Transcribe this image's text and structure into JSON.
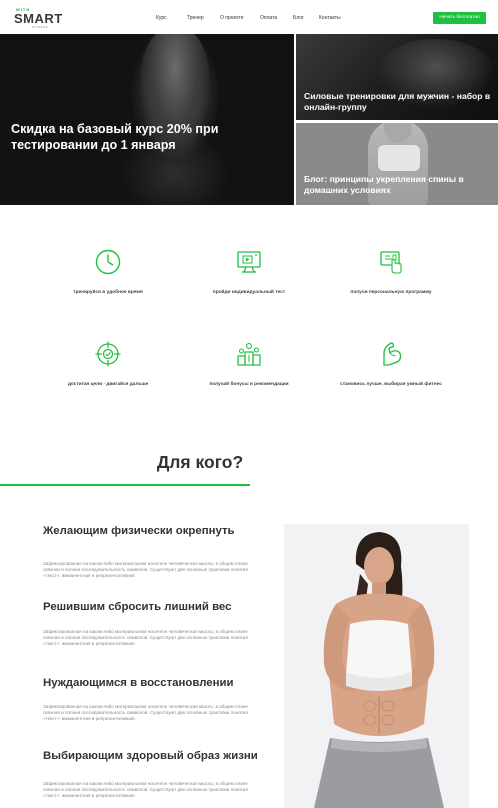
{
  "header": {
    "logo_small": "WITH",
    "logo_main": "SMART",
    "logo_sub": "FITNESS",
    "nav": [
      "Курс",
      "Тренер",
      "О проекте",
      "Оплата",
      "Блог",
      "Контакты"
    ],
    "cta_label": "Начать бесплатно"
  },
  "hero": {
    "main_title": "Скидка на базовый курс 20% при тестировании до 1 января",
    "top_right_title": "Силовые тренировки для мужчин - набор в онлайн-группу",
    "bottom_right_title": "Блог: принципы укрепления спины в домашних условиях"
  },
  "features": [
    {
      "label": "тренируйся в удобное время",
      "icon": "clock-icon"
    },
    {
      "label": "пройди индивидуальный тест",
      "icon": "monitor-icon"
    },
    {
      "label": "получи персональную программу",
      "icon": "tablet-icon"
    },
    {
      "label": "достигая цели - двигайся дальше",
      "icon": "target-icon"
    },
    {
      "label": "получай бонусы и рекомендации",
      "icon": "podium-icon"
    },
    {
      "label": "становись лучше, выбирая умный фитнес",
      "icon": "bicep-icon"
    }
  ],
  "audience": {
    "title": "Для кого?",
    "items": [
      {
        "title": "Желающим физически окрепнуть",
        "text": "Зафиксированная на каком-либо материальном носителе человеческая мысль; в общем плане связная и полная последовательность символов. Существуют две основные трактовки понятия «текст»: имманентная и репрезентативная."
      },
      {
        "title": "Решившим сбросить лишний вес",
        "text": "Зафиксированная на каком-либо материальном носителе человеческая мысль; в общем плане связная и полная последовательность символов. Существуют две основные трактовки понятия «текст»: имманентная и репрезентативная."
      },
      {
        "title": "Нуждающимся в восстановлении",
        "text": "Зафиксированная на каком-либо материальном носителе человеческая мысль; в общем плане связная и полная последовательность символов. Существуют две основные трактовки понятия «текст»: имманентная и репрезентативная."
      },
      {
        "title": "Выбирающим здоровый образ жизни",
        "text": "Зафиксированная на каком-либо материальном носителе человеческая мысль; в общем плане связная и полная последовательность символов. Существуют две основные трактовки понятия «текст»: имманентная и репрезентативная."
      }
    ]
  },
  "colors": {
    "accent": "#1fbf3f",
    "dark": "#111111",
    "text": "#333333"
  }
}
